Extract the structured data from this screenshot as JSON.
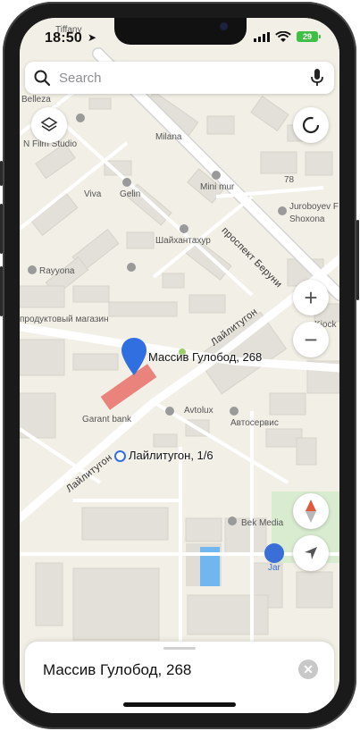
{
  "status_bar": {
    "time": "18:50",
    "battery": "29"
  },
  "search": {
    "placeholder": "Search"
  },
  "colors": {
    "road": "#ffffff",
    "road_main": "#d8d8d8",
    "building": "#dfddd5",
    "map_bg": "#f2efe6",
    "pin": "#2f6fe0",
    "highlight": "#e9837b",
    "water": "#6fb7ee",
    "park": "#cde8c4"
  },
  "map": {
    "selected_pin": {
      "label": "Массив Гулобод, 268",
      "icon": "map-pin-icon"
    },
    "address_marker": {
      "label": "Лайлитугон, 1/6",
      "icon": "address-ring-icon"
    },
    "streets": [
      {
        "name": "проспект Беруни"
      },
      {
        "name": "Лайлитугон"
      },
      {
        "name": "Лайлитугон"
      }
    ],
    "pois": [
      {
        "name": "Tiffany"
      },
      {
        "name": "Belleza"
      },
      {
        "name": "N Film Studio"
      },
      {
        "name": "Milana"
      },
      {
        "name": "Mini mur"
      },
      {
        "name": "Viva"
      },
      {
        "name": "Gelin"
      },
      {
        "name": "Шайхантахур"
      },
      {
        "name": "Juroboyev F"
      },
      {
        "name": "Shoxona"
      },
      {
        "name": "Rayyona"
      },
      {
        "name": "продуктовый магазин"
      },
      {
        "name": "Kiосk"
      },
      {
        "name": "Avtolux"
      },
      {
        "name": "Автосервис"
      },
      {
        "name": "Garant bank"
      },
      {
        "name": "Bek Media"
      },
      {
        "name": "Jar"
      }
    ],
    "house_numbers": [
      "78"
    ],
    "controls": {
      "layers_icon": "layers-icon",
      "compass_icon": "compass-dial-icon",
      "zoom_in": "+",
      "zoom_out": "−",
      "north_icon": "north-compass-icon",
      "locate_icon": "navigation-arrow-icon"
    }
  },
  "sheet": {
    "title": "Массив Гулобод, 268",
    "close": "✕"
  }
}
